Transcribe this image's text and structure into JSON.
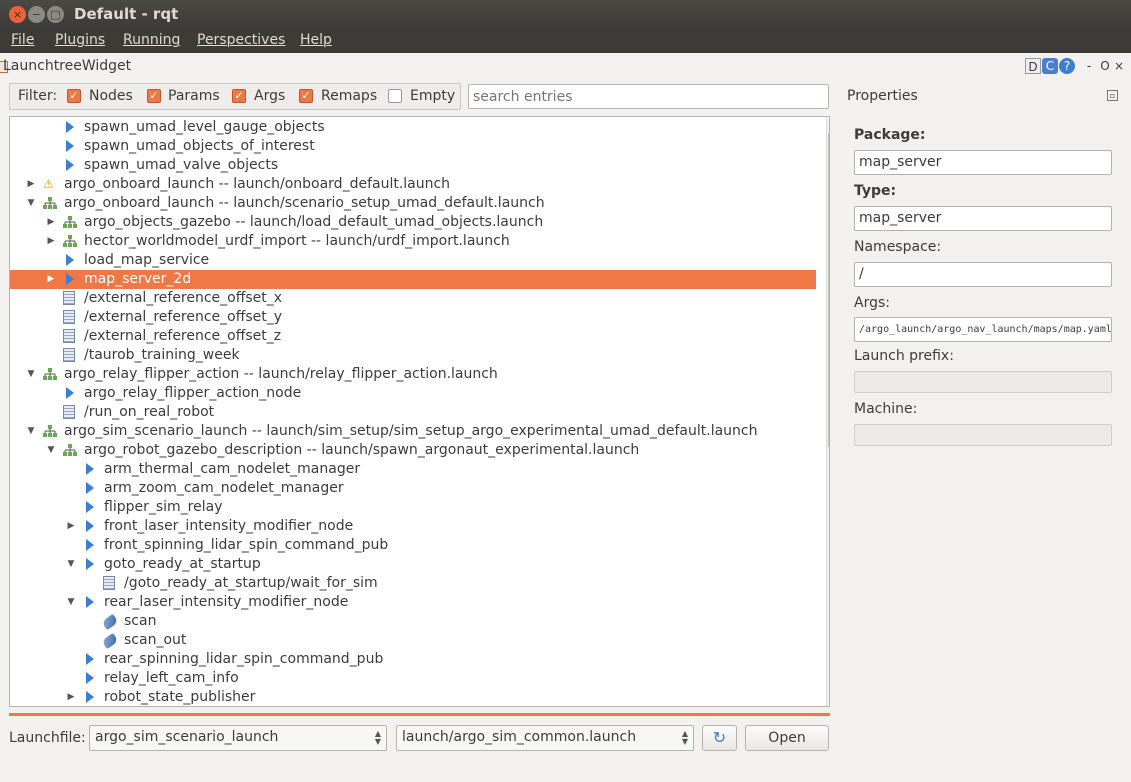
{
  "window": {
    "title": "Default - rqt",
    "close_glyph": "×",
    "min_glyph": "−",
    "max_glyph": "□"
  },
  "menubar": [
    "File",
    "Plugins",
    "Running",
    "Perspectives",
    "Help"
  ],
  "widget": {
    "title": "LaunchtreeWidget",
    "header_buttons": [
      "D",
      "C",
      "?",
      "-",
      "O",
      "×"
    ]
  },
  "filter": {
    "label": "Filter:",
    "options": [
      {
        "label": "Nodes",
        "checked": true
      },
      {
        "label": "Params",
        "checked": true
      },
      {
        "label": "Args",
        "checked": true
      },
      {
        "label": "Remaps",
        "checked": true
      },
      {
        "label": "Empty",
        "checked": false
      }
    ],
    "search_placeholder": "search entries"
  },
  "tree": [
    {
      "depth": 2,
      "expander": "",
      "icon": "node",
      "text": "spawn_umad_level_gauge_objects"
    },
    {
      "depth": 2,
      "expander": "",
      "icon": "node",
      "text": "spawn_umad_objects_of_interest"
    },
    {
      "depth": 2,
      "expander": "",
      "icon": "node",
      "text": "spawn_umad_valve_objects"
    },
    {
      "depth": 1,
      "expander": "collapsed",
      "icon": "warning",
      "text": "argo_onboard_launch -- launch/onboard_default.launch"
    },
    {
      "depth": 1,
      "expander": "expanded",
      "icon": "launch",
      "text": "argo_onboard_launch -- launch/scenario_setup_umad_default.launch"
    },
    {
      "depth": 2,
      "expander": "collapsed",
      "icon": "launch",
      "text": "argo_objects_gazebo -- launch/load_default_umad_objects.launch"
    },
    {
      "depth": 2,
      "expander": "collapsed",
      "icon": "launch",
      "text": "hector_worldmodel_urdf_import -- launch/urdf_import.launch"
    },
    {
      "depth": 2,
      "expander": "",
      "icon": "node",
      "text": "load_map_service"
    },
    {
      "depth": 2,
      "expander": "collapsed",
      "icon": "node",
      "text": "map_server_2d",
      "selected": true
    },
    {
      "depth": 2,
      "expander": "",
      "icon": "param",
      "text": "/external_reference_offset_x"
    },
    {
      "depth": 2,
      "expander": "",
      "icon": "param",
      "text": "/external_reference_offset_y"
    },
    {
      "depth": 2,
      "expander": "",
      "icon": "param",
      "text": "/external_reference_offset_z"
    },
    {
      "depth": 2,
      "expander": "",
      "icon": "param",
      "text": "/taurob_training_week"
    },
    {
      "depth": 1,
      "expander": "expanded",
      "icon": "launch",
      "text": "argo_relay_flipper_action -- launch/relay_flipper_action.launch"
    },
    {
      "depth": 2,
      "expander": "",
      "icon": "node",
      "text": "argo_relay_flipper_action_node"
    },
    {
      "depth": 2,
      "expander": "",
      "icon": "param",
      "text": "/run_on_real_robot"
    },
    {
      "depth": 1,
      "expander": "expanded",
      "icon": "launch",
      "text": "argo_sim_scenario_launch -- launch/sim_setup/sim_setup_argo_experimental_umad_default.launch"
    },
    {
      "depth": 2,
      "expander": "expanded",
      "icon": "launch",
      "text": "argo_robot_gazebo_description -- launch/spawn_argonaut_experimental.launch"
    },
    {
      "depth": 3,
      "expander": "",
      "icon": "node",
      "text": "arm_thermal_cam_nodelet_manager"
    },
    {
      "depth": 3,
      "expander": "",
      "icon": "node",
      "text": "arm_zoom_cam_nodelet_manager"
    },
    {
      "depth": 3,
      "expander": "",
      "icon": "node",
      "text": "flipper_sim_relay"
    },
    {
      "depth": 3,
      "expander": "collapsed",
      "icon": "node",
      "text": "front_laser_intensity_modifier_node"
    },
    {
      "depth": 3,
      "expander": "",
      "icon": "node",
      "text": "front_spinning_lidar_spin_command_pub"
    },
    {
      "depth": 3,
      "expander": "expanded",
      "icon": "node",
      "text": "goto_ready_at_startup"
    },
    {
      "depth": 4,
      "expander": "",
      "icon": "param",
      "text": "/goto_ready_at_startup/wait_for_sim"
    },
    {
      "depth": 3,
      "expander": "expanded",
      "icon": "node",
      "text": "rear_laser_intensity_modifier_node"
    },
    {
      "depth": 4,
      "expander": "",
      "icon": "topic",
      "text": "scan"
    },
    {
      "depth": 4,
      "expander": "",
      "icon": "topic",
      "text": "scan_out"
    },
    {
      "depth": 3,
      "expander": "",
      "icon": "node",
      "text": "rear_spinning_lidar_spin_command_pub"
    },
    {
      "depth": 3,
      "expander": "",
      "icon": "node",
      "text": "relay_left_cam_info"
    },
    {
      "depth": 3,
      "expander": "collapsed",
      "icon": "node",
      "text": "robot_state_publisher"
    }
  ],
  "bottom": {
    "launchfile_label": "Launchfile:",
    "package_value": "argo_sim_scenario_launch",
    "file_value": "launch/argo_sim_common.launch",
    "reload_glyph": "↻",
    "open_label": "Open"
  },
  "properties": {
    "title": "Properties",
    "package_label": "Package:",
    "package_value": "map_server",
    "type_label": "Type:",
    "type_value": "map_server",
    "namespace_label": "Namespace:",
    "namespace_value": "/",
    "args_label": "Args:",
    "args_value": "/argo_launch/argo_nav_launch/maps/map.yaml",
    "launch_prefix_label": "Launch prefix:",
    "launch_prefix_value": "",
    "machine_label": "Machine:",
    "machine_value": ""
  },
  "colors": {
    "accent": "#f07746",
    "node_icon": "#3a7fd1",
    "titlebar": "#3c3b37"
  }
}
